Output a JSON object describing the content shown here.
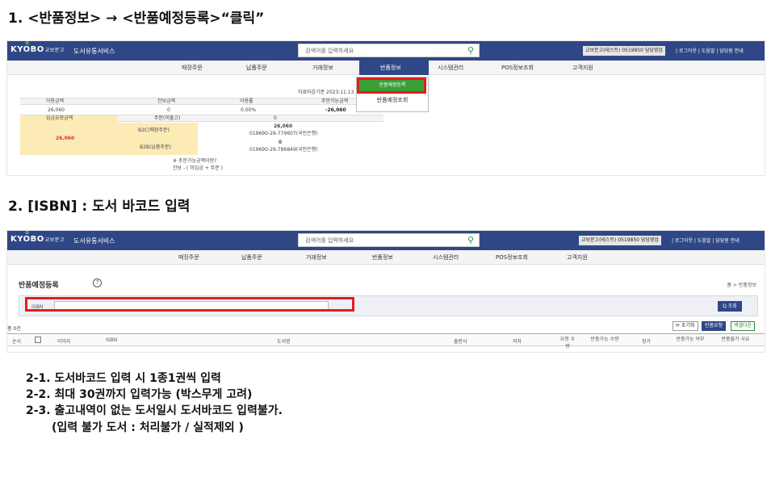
{
  "step1": "1. <반품정보> → <반품예정등록>“클릭”",
  "step2": "2. [ISBN] : 도서 바코드 입력",
  "app": {
    "logo": "KYOBO",
    "logo_sub": "교보문고",
    "service": "도서유통서비스",
    "search_placeholder": "검색어를 입력하세요",
    "user": "교보문고(테스트) 0519850 담당영업",
    "links": "|  로그아웃  |  도움말  |  담당원 안내",
    "menu": [
      "매장주문",
      "납품주문",
      "거래정보",
      "반품정보",
      "시스템관리",
      "POS정보조회",
      "고객지원"
    ]
  },
  "dropdown": {
    "selected": "반품예정등록",
    "other": "반품예정조회"
  },
  "summary": {
    "deadline": "자료마감기준 2023.11.13",
    "headers": [
      "이용금액",
      "잔보금액",
      "이용률",
      "주문가능금액"
    ],
    "values": [
      "26,060",
      "0",
      "0.00%",
      "-26,060"
    ],
    "left_header": "입금요청금액",
    "order_header": "주문(미출고)",
    "b2c": "B2C(매장주문)",
    "b2b": "B2B(납품주문)",
    "total": "26,060",
    "zero": "0",
    "b2c_amount": "26,060",
    "b2c_account": "019690-29-779607(국민은행)",
    "b2b_amount": "0",
    "b2b_account": "019690-29-786849(국민은행)",
    "note1": "※ 주문가능금액이란?",
    "note2": "잔보 - ( 미입금 + 주문 )"
  },
  "screen2": {
    "title": "반품예정등록",
    "breadcrumb": "홈 > 반품정보",
    "isbn_label": "ISBN",
    "search_btn": "Q 조회",
    "count": "총 0건",
    "btn_reset": "⟳ 초기화",
    "btn_return": "반품요청",
    "btn_excel": "엑셀다운",
    "columns": [
      "순서",
      "이미지",
      "ISBN",
      "도서명",
      "출판사",
      "저자",
      "요청 수량",
      "반품가능 수량",
      "정가",
      "반품가능 여부",
      "반품불가 사유"
    ]
  },
  "notes": [
    "2-1. 도서바코드 입력 시 1종1권씩 입력",
    "2-2. 최대 30권까지 입력가능 (박스무게 고려)",
    "2-3. 출고내역이 없는 도서일시 도서바코드 입력불가.",
    "(입력 불가 도서 : 처리불가 / 실적제외 )"
  ]
}
